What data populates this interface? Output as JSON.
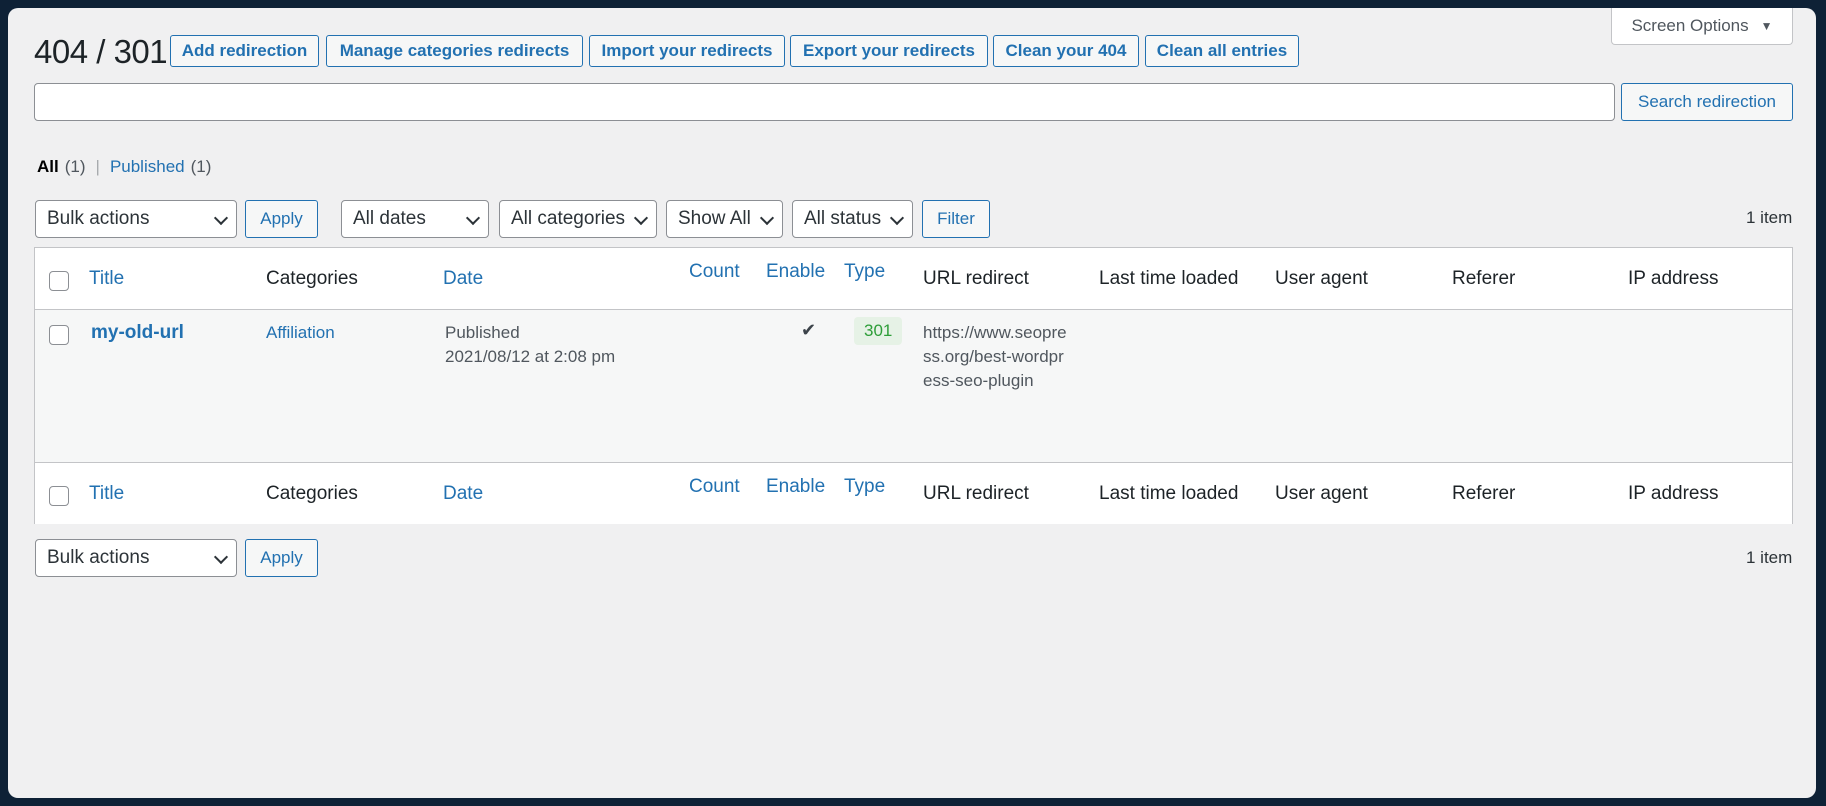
{
  "page": {
    "title": "404 / 301",
    "screen_options_label": "Screen Options"
  },
  "header_buttons": [
    "Add redirection",
    "Manage categories redirects",
    "Import your redirects",
    "Export your redirects",
    "Clean your 404",
    "Clean all entries"
  ],
  "search": {
    "value": "",
    "button_label": "Search redirection"
  },
  "views": {
    "all_label": "All",
    "all_count": "(1)",
    "separator": "|",
    "published_label": "Published",
    "published_count": "(1)"
  },
  "top_nav": {
    "bulk_actions": "Bulk actions",
    "apply": "Apply",
    "dates": "All dates",
    "categories": "All categories",
    "show": "Show All",
    "status": "All status",
    "filter": "Filter",
    "count": "1 item"
  },
  "bottom_nav": {
    "bulk_actions": "Bulk actions",
    "apply": "Apply",
    "count": "1 item"
  },
  "columns": {
    "title": "Title",
    "categories": "Categories",
    "date": "Date",
    "count": "Count",
    "enable": "Enable",
    "type": "Type",
    "url_redirect": "URL redirect",
    "last_time_loaded": "Last time loaded",
    "user_agent": "User agent",
    "referer": "Referer",
    "ip_address": "IP address"
  },
  "rows": [
    {
      "title": "my-old-url",
      "category": "Affiliation",
      "date_status": "Published",
      "date_value": "2021/08/12 at 2:08 pm",
      "count": "",
      "enabled": true,
      "enable_icon": "checkmark-icon",
      "type": "301",
      "url_redirect": "https://www.seopress.org/best-wordpress-seo-plugin",
      "last_time_loaded": "",
      "user_agent": "",
      "referer": "",
      "ip_address": ""
    }
  ],
  "colors": {
    "accent": "#2271b1",
    "badge_bg": "#e6f2e6",
    "badge_text": "#2e9e39",
    "frame_border": "#0e2136"
  }
}
